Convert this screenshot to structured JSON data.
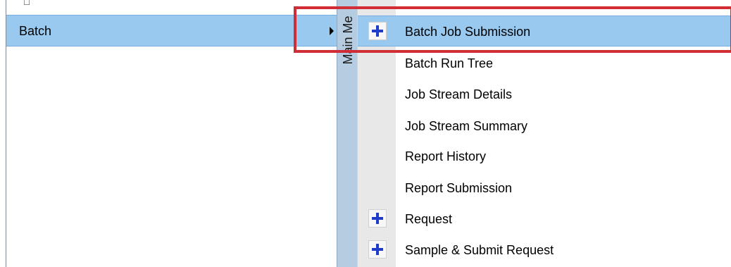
{
  "left_menu": {
    "batch_label": "Batch"
  },
  "vertical_strip": {
    "label": "Main Me"
  },
  "submenu": {
    "items": [
      {
        "label": "Batch Job Submission",
        "icon": "plus-icon"
      },
      {
        "label": "Batch Run Tree",
        "icon": ""
      },
      {
        "label": "Job Stream Details",
        "icon": ""
      },
      {
        "label": "Job Stream Summary",
        "icon": ""
      },
      {
        "label": "Report History",
        "icon": ""
      },
      {
        "label": "Report Submission",
        "icon": ""
      },
      {
        "label": "Request",
        "icon": "plus-icon"
      },
      {
        "label": "Sample & Submit Request",
        "icon": "plus-icon"
      }
    ]
  },
  "colors": {
    "selection_blue": "#99c9ef",
    "strip_blue": "#b6cce0",
    "plus_blue": "#1e3cc8",
    "highlight_red": "#d12d36"
  }
}
